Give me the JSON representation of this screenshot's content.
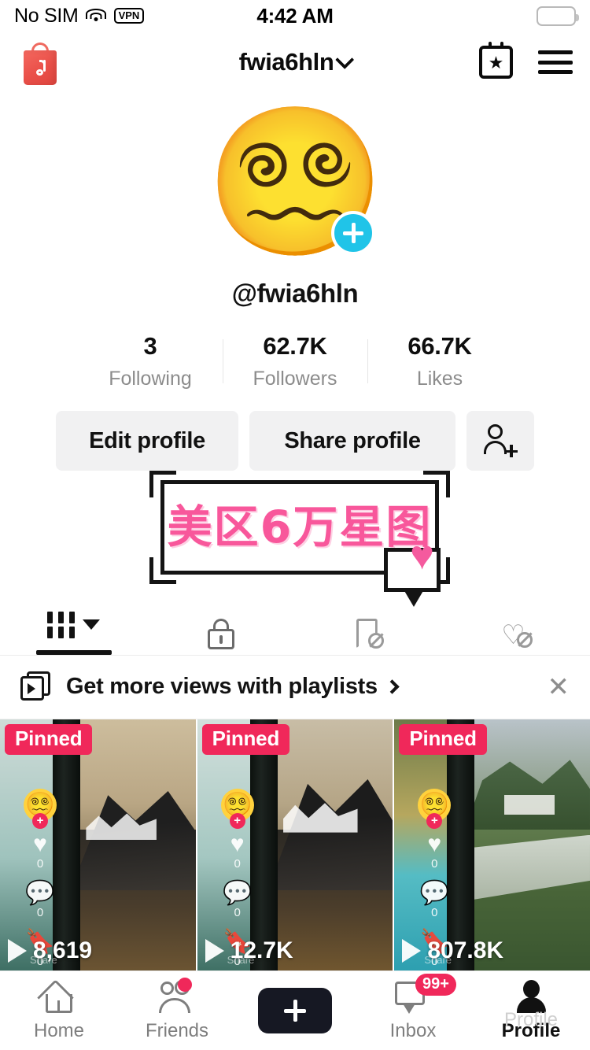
{
  "statusbar": {
    "carrier": "No SIM",
    "vpn": "VPN",
    "time": "4:42 AM",
    "wifi_icon": "wifi-icon",
    "battery_icon": "battery-icon"
  },
  "header": {
    "shop_icon": "tiktok-shop-bag-icon",
    "title": "fwia6hln",
    "chevron_icon": "chevron-down-icon",
    "calendar_icon": "calendar-star-icon",
    "menu_icon": "hamburger-menu-icon"
  },
  "profile": {
    "avatar_emoji": "😵‍💫",
    "add_badge_icon": "plus-badge-icon",
    "handle": "@fwia6hln",
    "stats": [
      {
        "num": "3",
        "label": "Following"
      },
      {
        "num": "62.7K",
        "label": "Followers"
      },
      {
        "num": "66.7K",
        "label": "Likes"
      }
    ],
    "actions": {
      "edit_label": "Edit profile",
      "share_label": "Share profile",
      "add_user_icon": "add-user-icon"
    },
    "banner": {
      "text": "美区6万星图",
      "heart_glyph": "♥",
      "text_color": "#f8579b"
    }
  },
  "tabs": [
    {
      "name": "grid",
      "icon": "grid-icon",
      "active": true
    },
    {
      "name": "private",
      "icon": "lock-icon",
      "active": false
    },
    {
      "name": "saved",
      "icon": "bookmark-hidden-icon",
      "active": false
    },
    {
      "name": "liked",
      "icon": "heart-hidden-icon",
      "active": false
    }
  ],
  "promo": {
    "icon": "playlist-icon",
    "text": "Get more views with playlists",
    "chevron": "chevron-right-icon",
    "close_icon": "close-icon"
  },
  "videos": [
    {
      "pinned_label": "Pinned",
      "views": "8,619",
      "likes": "0",
      "comments": "0",
      "saves": "0",
      "share_label": "Share",
      "avatar_emoji": "😵‍💫"
    },
    {
      "pinned_label": "Pinned",
      "views": "12.7K",
      "likes": "0",
      "comments": "0",
      "saves": "0",
      "share_label": "Share",
      "avatar_emoji": "😵‍💫"
    },
    {
      "pinned_label": "Pinned",
      "views": "807.8K",
      "likes": "0",
      "comments": "0",
      "saves": "0",
      "share_label": "Share",
      "avatar_emoji": "😵‍💫"
    }
  ],
  "bottomnav": {
    "items": [
      {
        "label": "Home",
        "icon": "home-icon",
        "active": false
      },
      {
        "label": "Friends",
        "icon": "friends-icon",
        "active": false,
        "dot": true
      },
      {
        "label": "",
        "icon": "create-plus-icon",
        "active": false
      },
      {
        "label": "Inbox",
        "icon": "inbox-icon",
        "active": false,
        "badge": "99+"
      },
      {
        "label": "Profile",
        "icon": "profile-icon",
        "active": true
      }
    ],
    "profile_ghost": "Profile"
  },
  "colors": {
    "accent_pink": "#f0285a",
    "accent_cyan": "#20c4e8",
    "banner_pink": "#f8579b",
    "dark": "#161823"
  }
}
